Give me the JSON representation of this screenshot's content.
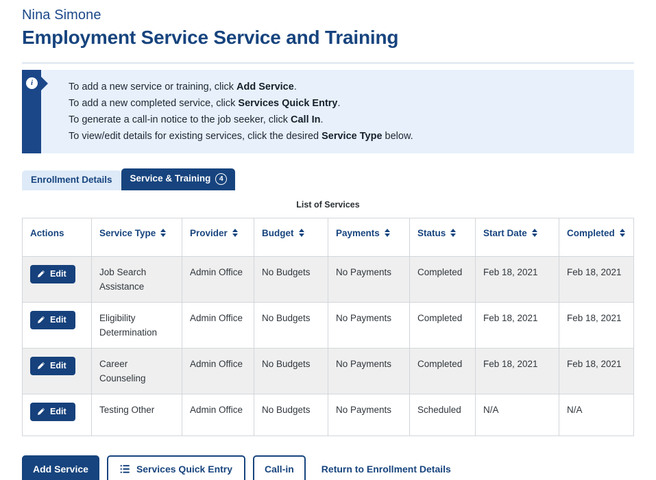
{
  "header": {
    "subject_name": "Nina Simone",
    "page_title": "Employment Service Service and Training"
  },
  "info_banner": {
    "icon": "info-circle-icon",
    "lines": [
      {
        "prefix": "To add a new service or training, click ",
        "strong": "Add Service",
        "suffix": "."
      },
      {
        "prefix": "To add a new completed service, click ",
        "strong": "Services Quick Entry",
        "suffix": "."
      },
      {
        "prefix": "To generate a call-in notice to the job seeker, click ",
        "strong": "Call In",
        "suffix": "."
      },
      {
        "prefix": "To view/edit details for existing services, click the desired ",
        "strong": "Service Type",
        "suffix": " below."
      }
    ]
  },
  "tabs": [
    {
      "label": "Enrollment Details",
      "active": false,
      "badge": null
    },
    {
      "label": "Service & Training",
      "active": true,
      "badge": "4"
    }
  ],
  "table": {
    "caption": "List of Services",
    "columns": [
      {
        "label": "Actions",
        "sortable": false
      },
      {
        "label": "Service Type",
        "sortable": true
      },
      {
        "label": "Provider",
        "sortable": true
      },
      {
        "label": "Budget",
        "sortable": true
      },
      {
        "label": "Payments",
        "sortable": true
      },
      {
        "label": "Status",
        "sortable": true
      },
      {
        "label": "Start Date",
        "sortable": true
      },
      {
        "label": "Completed",
        "sortable": true
      }
    ],
    "edit_label": "Edit",
    "rows": [
      {
        "service_type": "Job Search Assistance",
        "provider": "Admin Office",
        "budget": "No Budgets",
        "payments": "No Payments",
        "status": "Completed",
        "start_date": "Feb 18, 2021",
        "completed": "Feb 18, 2021"
      },
      {
        "service_type": "Eligibility Determination",
        "provider": "Admin Office",
        "budget": "No Budgets",
        "payments": "No Payments",
        "status": "Completed",
        "start_date": "Feb 18, 2021",
        "completed": "Feb 18, 2021"
      },
      {
        "service_type": "Career Counseling",
        "provider": "Admin Office",
        "budget": "No Budgets",
        "payments": "No Payments",
        "status": "Completed",
        "start_date": "Feb 18, 2021",
        "completed": "Feb 18, 2021"
      },
      {
        "service_type": "Testing Other",
        "provider": "Admin Office",
        "budget": "No Budgets",
        "payments": "No Payments",
        "status": "Scheduled",
        "start_date": "N/A",
        "completed": "N/A"
      }
    ]
  },
  "footer": {
    "add_service_label": "Add Service",
    "quick_entry_label": "Services Quick Entry",
    "call_in_label": "Call-in",
    "return_link_label": "Return to Enrollment Details"
  },
  "colors": {
    "brand_navy": "#17447e",
    "banner_bg": "#e7f0fb",
    "tab_inactive_bg": "#deeaf8",
    "row_alt_bg": "#efefef"
  }
}
